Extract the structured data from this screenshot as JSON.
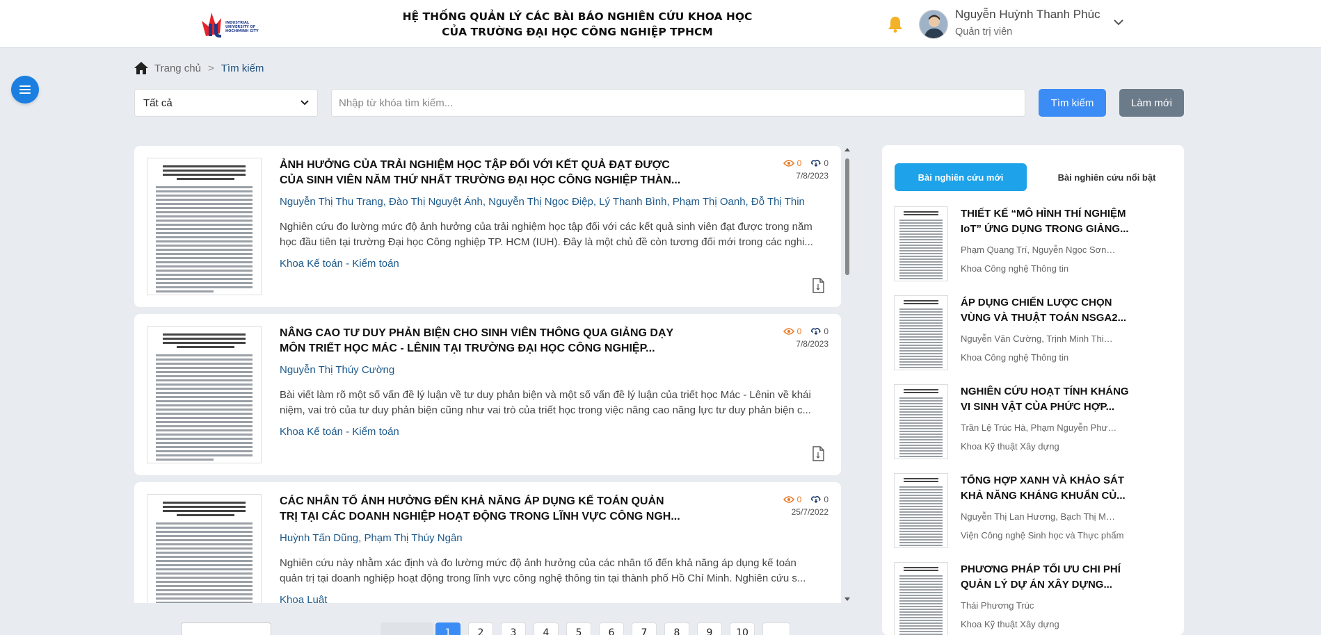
{
  "header": {
    "title_line1": "HỆ THỐNG QUẢN LÝ CÁC BÀI BÁO NGHIÊN CỨU KHOA HỌC",
    "title_line2": "CỦA TRƯỜNG ĐẠI HỌC CÔNG NGHIỆP TPHCM",
    "logo_text": "INDUSTRIAL UNIVERSITY OF HOCHIMINH CITY",
    "logo_icon": "iuh-logo",
    "notification_icon": "bell-icon",
    "user_name": "Nguyễn Huỳnh Thanh Phúc",
    "user_role": "Quản trị viên"
  },
  "breadcrumb": {
    "home": "Trang chủ",
    "separator": ">",
    "current": "Tìm kiếm"
  },
  "search": {
    "filter_options": [
      "Tất cả"
    ],
    "filter_selected": "Tất cả",
    "placeholder": "Nhập từ khóa tìm kiếm...",
    "value": "",
    "search_label": "Tìm kiếm",
    "reset_label": "Làm mới"
  },
  "results": [
    {
      "title_line1": "ẢNH HƯỞNG CỦA TRẢI NGHIỆM HỌC TẬP ĐỐI VỚI KẾT QUẢ ĐẠT ĐƯỢC",
      "title_line2": "CỦA SINH VIÊN NĂM THỨ NHẤT TRƯỜNG ĐẠI HỌC CÔNG NGHIỆP THÀN...",
      "authors": "Nguyễn Thị Thu Trang, Đào Thị Nguyệt Ánh, Nguyễn Thị Ngọc Điệp, Lý Thanh Bình, Phạm Thị Oanh, Đỗ Thị Thin",
      "abstract_line1": "Nghiên cứu đo lường mức độ ảnh hưởng của trải nghiệm học tập đối với các kết quả sinh viên đạt được trong năm",
      "abstract_line2": "học đầu tiên tại trường Đại học Công nghiệp TP. HCM (IUH). Đây là một chủ đề còn tương đối mới trong các nghi...",
      "department": "Khoa Kế toán - Kiểm toán",
      "views": "0",
      "downloads": "0",
      "date": "7/8/2023"
    },
    {
      "title_line1": "NÂNG CAO TƯ DUY PHẢN BIỆN CHO SINH VIÊN THÔNG QUA GIẢNG DẠY",
      "title_line2": "MÔN TRIẾT HỌC MÁC - LÊNIN TẠI TRƯỜNG ĐẠI HỌC CÔNG NGHIỆP...",
      "authors": "Nguyễn Thị Thúy Cường",
      "abstract_line1": "Bài viết làm rõ một số vấn đề lý luận về tư duy phản biện và một số vấn đề lý luận của triết học Mác - Lênin về khái",
      "abstract_line2": "niệm, vai trò của tư duy phản biện cũng như vai trò của triết học trong việc nâng cao năng lực tư duy phản biện c...",
      "department": "Khoa Kế toán - Kiểm toán",
      "views": "0",
      "downloads": "0",
      "date": "7/8/2023"
    },
    {
      "title_line1": "CÁC NHÂN TỐ ẢNH HƯỞNG ĐẾN KHẢ NĂNG ÁP DỤNG KẾ TOÁN QUẢN",
      "title_line2": "TRỊ TẠI CÁC DOANH NGHIỆP HOẠT ĐỘNG TRONG LĨNH VỰC CÔNG NGH...",
      "authors": "Huỳnh Tấn Dũng, Phạm Thị Thúy Ngân",
      "abstract_line1": "Nghiên cứu này nhằm xác định và đo lường mức độ ảnh hưởng của các nhân tố đến khả năng áp dụng kế toán",
      "abstract_line2": "quản trị tại doanh nghiệp hoạt động trong lĩnh vực công nghệ thông tin tại thành phố Hồ Chí Minh. Nghiên cứu s...",
      "department": "Khoa Luật",
      "views": "0",
      "downloads": "0",
      "date": "25/7/2022"
    }
  ],
  "pagination": {
    "pages": [
      "1",
      "2",
      "3",
      "4",
      "5",
      "6",
      "7",
      "8",
      "9",
      "10"
    ],
    "active_page": "1"
  },
  "side_panel": {
    "tab_new": "Bài nghiên cứu mới",
    "tab_hot": "Bài nghiên cứu nổi bật",
    "items": [
      {
        "title_line1": "THIẾT KẾ “MÔ HÌNH THÍ NGHIỆM",
        "title_line2": "IoT” ỨNG DỤNG TRONG GIẢNG...",
        "authors": "Phạm Quang Trí, Nguyễn Ngọc Sơn, Ca...",
        "department": "Khoa Công nghệ Thông tin"
      },
      {
        "title_line1": "ÁP DỤNG CHIẾN LƯỢC CHỌN",
        "title_line2": "VÙNG VÀ THUẬT TOÁN NSGA2...",
        "authors": "Nguyễn Văn Cường, Trịnh Minh Thiên...",
        "department": "Khoa Công nghệ Thông tin"
      },
      {
        "title_line1": "NGHIÊN CỨU HOẠT TÍNH KHÁNG",
        "title_line2": "VI SINH VẬT CỦA PHỨC HỢP...",
        "authors": "Trần Lệ Trúc Hà, Phạm Nguyễn Phương...",
        "department": "Khoa Kỹ thuật Xây dựng"
      },
      {
        "title_line1": "TỔNG HỢP XANH VÀ KHẢO SÁT",
        "title_line2": "KHẢ NĂNG KHÁNG KHUẨN CỦ...",
        "authors": "Nguyễn Thị Lan Hương, Bạch Thị Mỹ H...",
        "department": "Viện Công nghệ Sinh học và Thực phẩm"
      },
      {
        "title_line1": "PHƯƠNG PHÁP TỐI ƯU CHI PHÍ",
        "title_line2": "QUẢN LÝ DỰ ÁN XÂY DỰNG...",
        "authors": "Thái Phương Trúc",
        "department": "Khoa Kỹ thuật Xây dựng"
      }
    ]
  },
  "colors": {
    "primary": "#3b8cf5",
    "tab_active": "#1ea2e9",
    "link": "#1d5a8c",
    "views": "#e87722",
    "reset": "#6c7b8a"
  }
}
